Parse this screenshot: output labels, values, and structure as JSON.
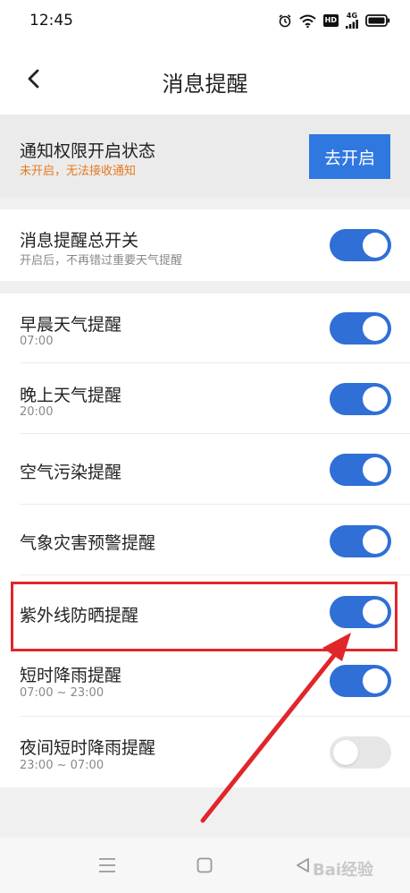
{
  "status_bar": {
    "time": "12:45",
    "icons": [
      "alarm-icon",
      "wifi-icon",
      "hd-icon",
      "signal-4g-icon",
      "battery-icon"
    ],
    "hd_label": "HD",
    "network_label": "4G"
  },
  "nav": {
    "title": "消息提醒",
    "back_icon": "chevron-left-icon"
  },
  "permission": {
    "title": "通知权限开启状态",
    "subtitle": "未开启，无法接收通知",
    "button_label": "去开启"
  },
  "master": {
    "title": "消息提醒总开关",
    "subtitle": "开启后，不再错过重要天气提醒",
    "enabled": true
  },
  "items": [
    {
      "title": "早晨天气提醒",
      "subtitle": "07:00",
      "enabled": true
    },
    {
      "title": "晚上天气提醒",
      "subtitle": "20:00",
      "enabled": true
    },
    {
      "title": "空气污染提醒",
      "subtitle": "",
      "enabled": true
    },
    {
      "title": "气象灾害预警提醒",
      "subtitle": "",
      "enabled": true
    },
    {
      "title": "紫外线防晒提醒",
      "subtitle": "",
      "enabled": true
    },
    {
      "title": "短时降雨提醒",
      "subtitle": "07:00 ~ 23:00",
      "enabled": true
    },
    {
      "title": "夜间短时降雨提醒",
      "subtitle": "23:00 ~ 07:00",
      "enabled": false
    }
  ],
  "colors": {
    "accent": "#2f78e0",
    "toggle_on": "#2f6fd6",
    "warning_text": "#e8781e",
    "annotation_red": "#e0262b"
  },
  "bottom_nav": {
    "icons": [
      "menu-icon",
      "home-square-icon",
      "back-triangle-icon"
    ]
  },
  "watermark": "Bai经验"
}
